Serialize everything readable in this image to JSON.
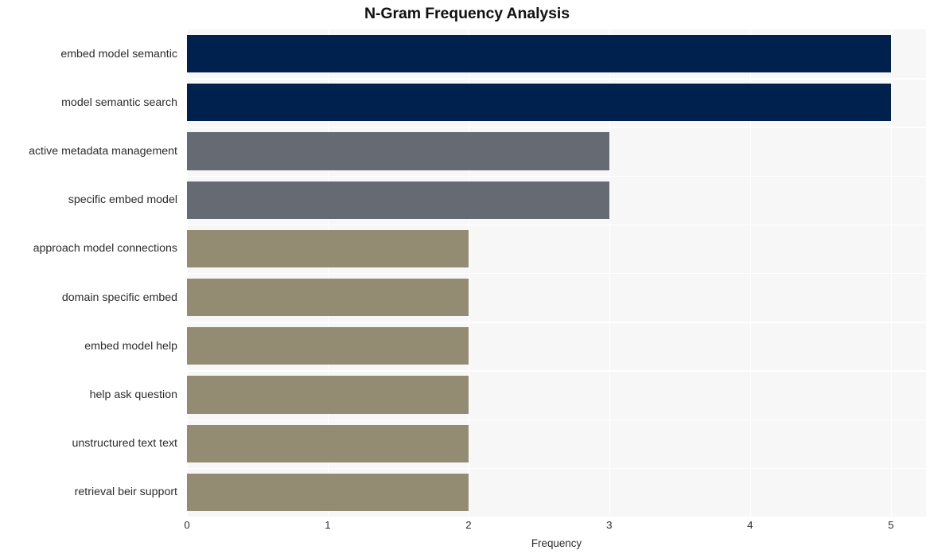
{
  "chart_data": {
    "type": "bar",
    "orientation": "horizontal",
    "title": "N-Gram Frequency Analysis",
    "xlabel": "Frequency",
    "ylabel": "",
    "categories": [
      "embed model semantic",
      "model semantic search",
      "active metadata management",
      "specific embed model",
      "approach model connections",
      "domain specific embed",
      "embed model help",
      "help ask question",
      "unstructured text text",
      "retrieval beir support"
    ],
    "values": [
      5,
      5,
      3,
      3,
      2,
      2,
      2,
      2,
      2,
      2
    ],
    "bar_colors": [
      "#00214d",
      "#00214d",
      "#666a73",
      "#666a73",
      "#938c73",
      "#938c73",
      "#938c73",
      "#938c73",
      "#938c73",
      "#938c73"
    ],
    "xlim": [
      0,
      5.25
    ],
    "xticks": [
      0,
      1,
      2,
      3,
      4,
      5
    ],
    "xtick_labels": [
      "0",
      "1",
      "2",
      "3",
      "4",
      "5"
    ],
    "grid": true,
    "grid_color": "#ffffff",
    "plot_background": "#f7f7f8",
    "figure_background": "#ffffff",
    "legend": null
  }
}
